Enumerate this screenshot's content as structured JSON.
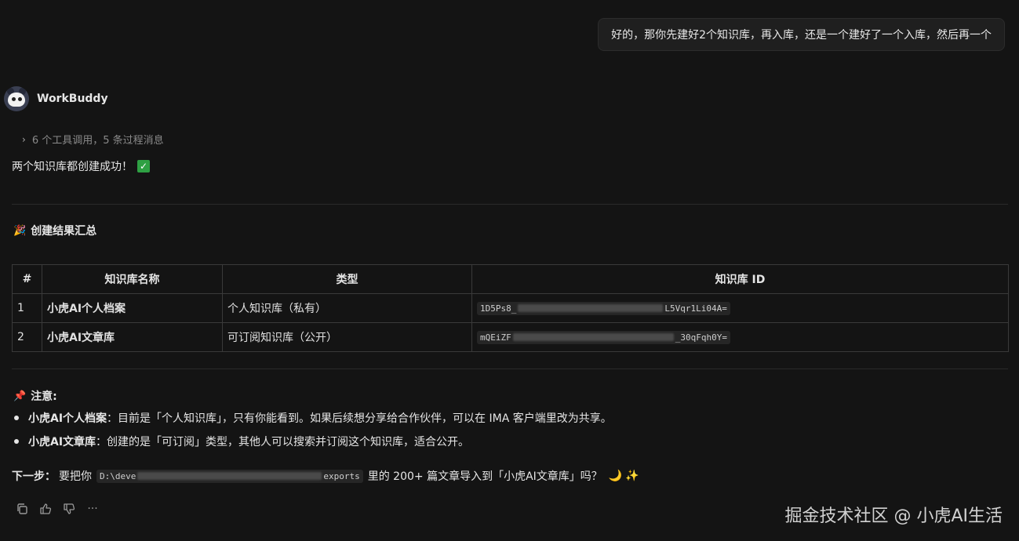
{
  "user_message": "好的，那你先建好2个知识库，再入库，还是一个建好了一个入库，然后再一个",
  "bot": {
    "name": "WorkBuddy"
  },
  "tools_summary": "6 个工具调用，5 条过程消息",
  "success_text": "两个知识库都创建成功！",
  "summary_title": "创建结果汇总",
  "table": {
    "headers": [
      "#",
      "知识库名称",
      "类型",
      "知识库 ID"
    ],
    "rows": [
      {
        "num": "1",
        "name": "小虎AI个人档案",
        "type": "个人知识库（私有）",
        "id_start": "1D5Ps8_",
        "id_end": "L5Vqr1Li04A="
      },
      {
        "num": "2",
        "name": "小虎AI文章库",
        "type": "可订阅知识库（公开）",
        "id_start": "mQEiZF",
        "id_end": "_30qFqh0Y="
      }
    ]
  },
  "note_title": "注意:",
  "notes": [
    {
      "head": "小虎AI个人档案",
      "text": "：目前是「个人知识库」，只有你能看到。如果后续想分享给合作伙伴，可以在 IMA 客户端里改为共享。"
    },
    {
      "head": "小虎AI文章库",
      "text": "：创建的是「可订阅」类型，其他人可以搜索并订阅这个知识库，适合公开。"
    }
  ],
  "next": {
    "label": "下一步：",
    "before": "要把你",
    "path_start": "D:\\deve",
    "path_end": "exports",
    "after": "里的 200+ 篇文章导入到「小虎AI文章库」吗？"
  },
  "watermark": "掘金技术社区 @ 小虎AI生活"
}
